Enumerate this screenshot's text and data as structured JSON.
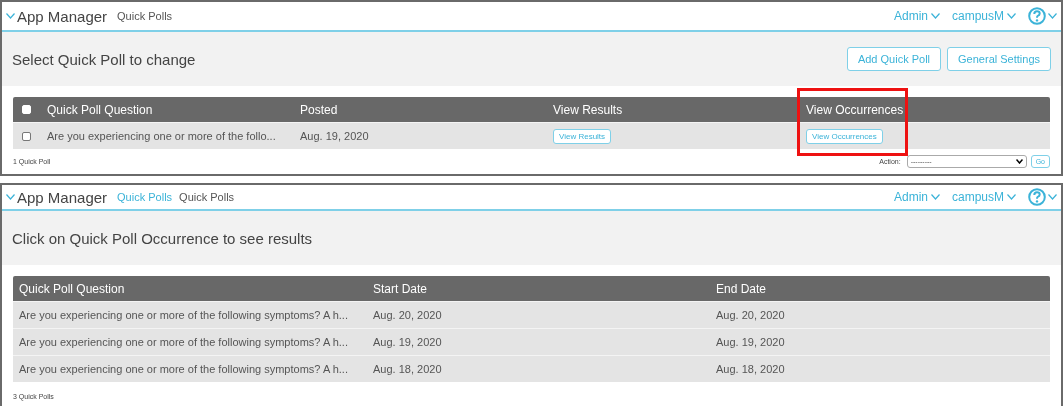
{
  "panels": [
    {
      "header": {
        "app": "App Manager",
        "breadcrumbs": [
          {
            "label": "Quick Polls",
            "link": false
          }
        ],
        "menus": [
          "Admin",
          "campusM"
        ]
      },
      "title": "Select Quick Poll to change",
      "buttons": [
        "Add Quick Poll",
        "General Settings"
      ],
      "table": {
        "select_all": {
          "checked": false
        },
        "columns": [
          {
            "label": "Quick Poll Question",
            "highlighted": false
          },
          {
            "label": "Posted",
            "highlighted": false
          },
          {
            "label": "View Results",
            "highlighted": false
          },
          {
            "label": "View Occurrences",
            "highlighted": true
          }
        ],
        "rows": [
          {
            "checked": false,
            "cells": [
              {
                "kind": "text",
                "text": "Are you experiencing one or more of the follo..."
              },
              {
                "kind": "text",
                "text": "Aug. 19, 2020"
              },
              {
                "kind": "button",
                "text": "View Results"
              },
              {
                "kind": "button",
                "text": "View Occurrences"
              }
            ]
          }
        ]
      },
      "footer": {
        "count": "1 Quick Poll",
        "action_label": "Action:",
        "action_value": "---------",
        "go": "Go"
      }
    },
    {
      "header": {
        "app": "App Manager",
        "breadcrumbs": [
          {
            "label": "Quick Polls",
            "link": true
          },
          {
            "label": "Quick Polls",
            "link": false
          }
        ],
        "menus": [
          "Admin",
          "campusM"
        ]
      },
      "title": "Click on Quick Poll Occurrence to see results",
      "table": {
        "columns": [
          {
            "label": "Quick Poll Question",
            "highlighted": false
          },
          {
            "label": "Start Date",
            "highlighted": false
          },
          {
            "label": "End Date",
            "highlighted": false
          }
        ],
        "rows": [
          {
            "cells": [
              {
                "kind": "text",
                "text": "Are you experiencing one or more of the following symptoms? A h..."
              },
              {
                "kind": "text",
                "text": "Aug. 20, 2020"
              },
              {
                "kind": "text",
                "text": "Aug. 20, 2020"
              }
            ]
          },
          {
            "cells": [
              {
                "kind": "text",
                "text": "Are you experiencing one or more of the following symptoms? A h..."
              },
              {
                "kind": "text",
                "text": "Aug. 19, 2020"
              },
              {
                "kind": "text",
                "text": "Aug. 19, 2020"
              }
            ]
          },
          {
            "cells": [
              {
                "kind": "text",
                "text": "Are you experiencing one or more of the following symptoms? A h..."
              },
              {
                "kind": "text",
                "text": "Aug. 18, 2020"
              },
              {
                "kind": "text",
                "text": "Aug. 18, 2020"
              }
            ]
          }
        ]
      },
      "footer": {
        "count": "3 Quick Polls"
      }
    }
  ]
}
